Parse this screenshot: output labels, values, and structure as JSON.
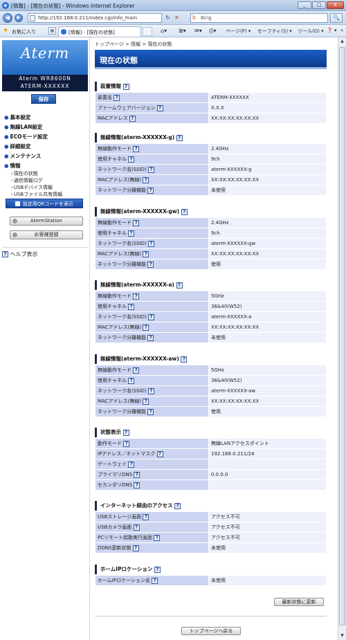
{
  "window": {
    "title": "[情報] - [現在の状態] - Windows Internet Explorer",
    "minimize": "_",
    "maximize": "□",
    "close": "X"
  },
  "nav": {
    "back": "◀",
    "forward": "▶",
    "url": "http://192.168.0.211/index.cgi/info_main",
    "refresh": "↻",
    "stop": "✕",
    "search_placeholder": "Bing",
    "search_icon": "bing-icon",
    "search_button": "🔍"
  },
  "favorites": {
    "label": "お気に入り",
    "tab_title": "[情報] - [現在の状態]"
  },
  "toolbar": {
    "page": "ページ(P) ▾",
    "safety": "セーフティ(S) ▾",
    "tools": "ツール(O) ▾",
    "help": "❓ ▾",
    "more": "»"
  },
  "sidebar": {
    "logo": "Aterm",
    "model": "Aterm WR8600N",
    "device_id": "ATERM-XXXXXX",
    "save": "保存",
    "menu": [
      {
        "label": "基本設定"
      },
      {
        "label": "無線LAN設定"
      },
      {
        "label": "ECOモード設定"
      },
      {
        "label": "詳細設定"
      },
      {
        "label": "メンテナンス"
      },
      {
        "label": "情報"
      }
    ],
    "submenu": [
      "現在の状態",
      "通信情報ログ",
      "USBデバイス情報",
      "USBファイル共有情報"
    ],
    "qr_button": "設定用QRコードを表示",
    "aterm_station": "AtermStation",
    "customer_reg": "お客様登録",
    "help": "ヘルプ表示"
  },
  "main": {
    "breadcrumb": "トップページ > 情報 > 現在の状態",
    "title": "現在の状態",
    "sections": [
      {
        "title": "装置情報",
        "rows": [
          [
            "装置名",
            "ATERM-XXXXXX"
          ],
          [
            "ファームウェアバージョン",
            "X.X.X"
          ],
          [
            "MACアドレス",
            "XX:XX:XX:XX:XX:XX"
          ]
        ]
      },
      {
        "title": "無線情報(aterm-XXXXXX-g)",
        "rows": [
          [
            "無線動作モード",
            "2.4GHz"
          ],
          [
            "使用チャネル",
            "9ch"
          ],
          [
            "ネットワーク名(SSID)",
            "aterm-XXXXXX-g"
          ],
          [
            "MACアドレス(無線)",
            "XX:XX:XX:XX:XX:XX"
          ],
          [
            "ネットワーク分離機能",
            "未使用"
          ]
        ]
      },
      {
        "title": "無線情報(aterm-XXXXXX-gw)",
        "rows": [
          [
            "無線動作モード",
            "2.4GHz"
          ],
          [
            "使用チャネル",
            "9ch"
          ],
          [
            "ネットワーク名(SSID)",
            "aterm-XXXXXX-gw"
          ],
          [
            "MACアドレス(無線)",
            "XX:XX:XX:XX:XX:XX"
          ],
          [
            "ネットワーク分離機能",
            "使用"
          ]
        ]
      },
      {
        "title": "無線情報(aterm-XXXXXX-a)",
        "rows": [
          [
            "無線動作モード",
            "5GHz"
          ],
          [
            "使用チャネル",
            "36&40(W52)"
          ],
          [
            "ネットワーク名(SSID)",
            "aterm-XXXXXX-a"
          ],
          [
            "MACアドレス(無線)",
            "XX:XX:XX:XX:XX:XX"
          ],
          [
            "ネットワーク分離機能",
            "未使用"
          ]
        ]
      },
      {
        "title": "無線情報(aterm-XXXXXX-aw)",
        "rows": [
          [
            "無線動作モード",
            "5GHz"
          ],
          [
            "使用チャネル",
            "36&40(W52)"
          ],
          [
            "ネットワーク名(SSID)",
            "aterm-XXXXXX-aw"
          ],
          [
            "MACアドレス(無線)",
            "XX:XX:XX:XX:XX:XX"
          ],
          [
            "ネットワーク分離機能",
            "使用"
          ]
        ]
      },
      {
        "title": "状態表示",
        "rows": [
          [
            "動作モード",
            "無線LANアクセスポイント"
          ],
          [
            "IPアドレス／ネットマスク",
            "192.168.0.211/24"
          ],
          [
            "ゲートウェイ",
            ""
          ],
          [
            "プライマリDNS",
            "0.0.0.0"
          ],
          [
            "セカンダリDNS",
            ""
          ]
        ]
      },
      {
        "title": "インターネット経由のアクセス",
        "rows": [
          [
            "USBストレージ画面",
            "アクセス不可"
          ],
          [
            "USBカメラ画面",
            "アクセス不可"
          ],
          [
            "PCリモート起動実行画面",
            "アクセス不可"
          ],
          [
            "DDNS更新状態",
            "未使用"
          ]
        ]
      },
      {
        "title": "ホームIPロケーション",
        "rows": [
          [
            "ホームIPロケーション名",
            "未使用"
          ]
        ]
      }
    ],
    "refresh": "最新状態に更新",
    "top": "トップページへ戻る",
    "help_glyph": "?"
  }
}
